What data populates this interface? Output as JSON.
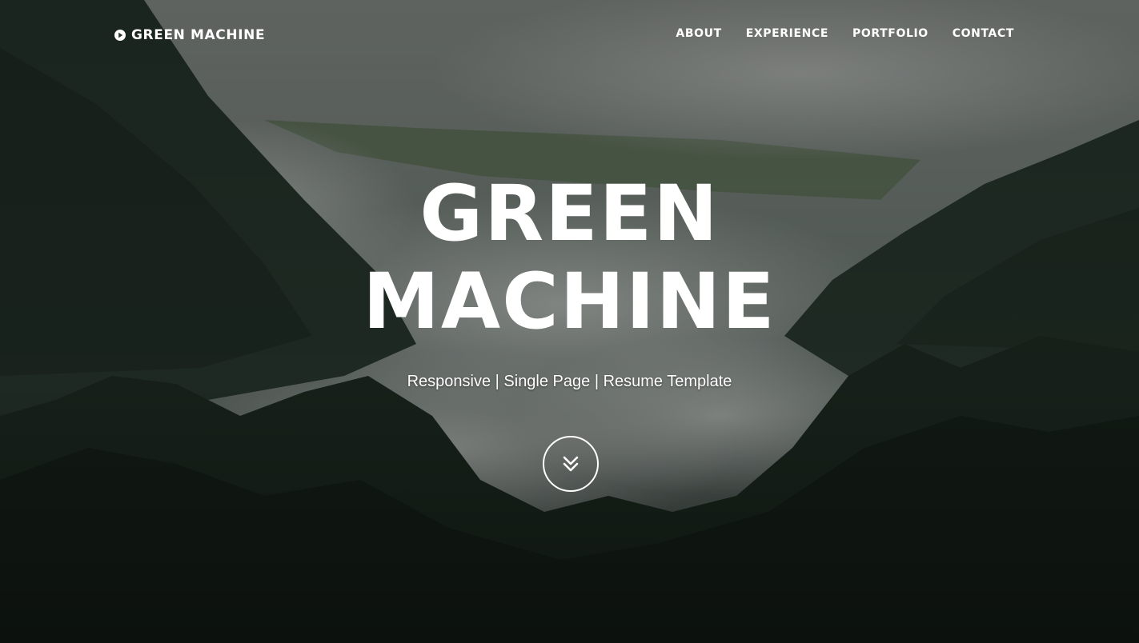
{
  "header": {
    "brand_label": "GREEN MACHINE",
    "brand_icon": "play-circle-icon",
    "nav": [
      {
        "label": "ABOUT"
      },
      {
        "label": "EXPERIENCE"
      },
      {
        "label": "PORTFOLIO"
      },
      {
        "label": "CONTACT"
      }
    ]
  },
  "hero": {
    "title_line_1": "GREEN",
    "title_line_2": "MACHINE",
    "subtitle": "Responsive | Single Page | Resume Template",
    "scroll_icon": "double-chevron-down-icon"
  },
  "colors": {
    "text": "#ffffff",
    "overlay": "#1e2622"
  }
}
